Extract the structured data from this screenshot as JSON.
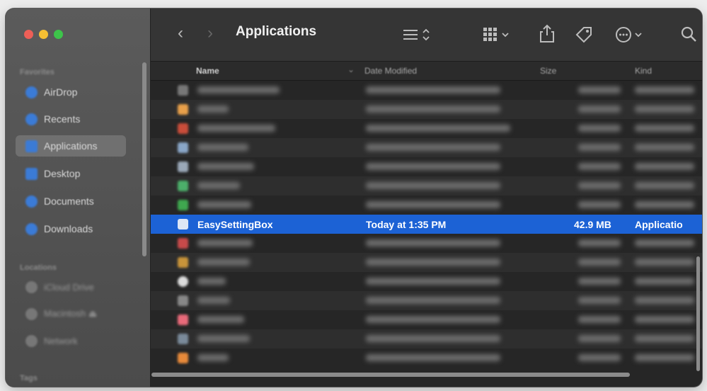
{
  "window": {
    "title": "Applications"
  },
  "sidebar": {
    "section_favorites": "",
    "items": [
      {
        "label": "AirDrop"
      },
      {
        "label": "Recents"
      },
      {
        "label": "Applications",
        "selected": true
      },
      {
        "label": "Desktop"
      },
      {
        "label": "Documents"
      },
      {
        "label": "Downloads"
      }
    ]
  },
  "columns": {
    "name": "Name",
    "date": "",
    "size": "",
    "kind": ""
  },
  "selected_row": {
    "name": "EasySettingBox",
    "date": "Today at 1:35 PM",
    "size": "42.9 MB",
    "kind": "Applicatio"
  },
  "colors": {
    "selection": "#1c62d5",
    "sidebar_bg": "#505050",
    "list_bg": "#262626"
  }
}
